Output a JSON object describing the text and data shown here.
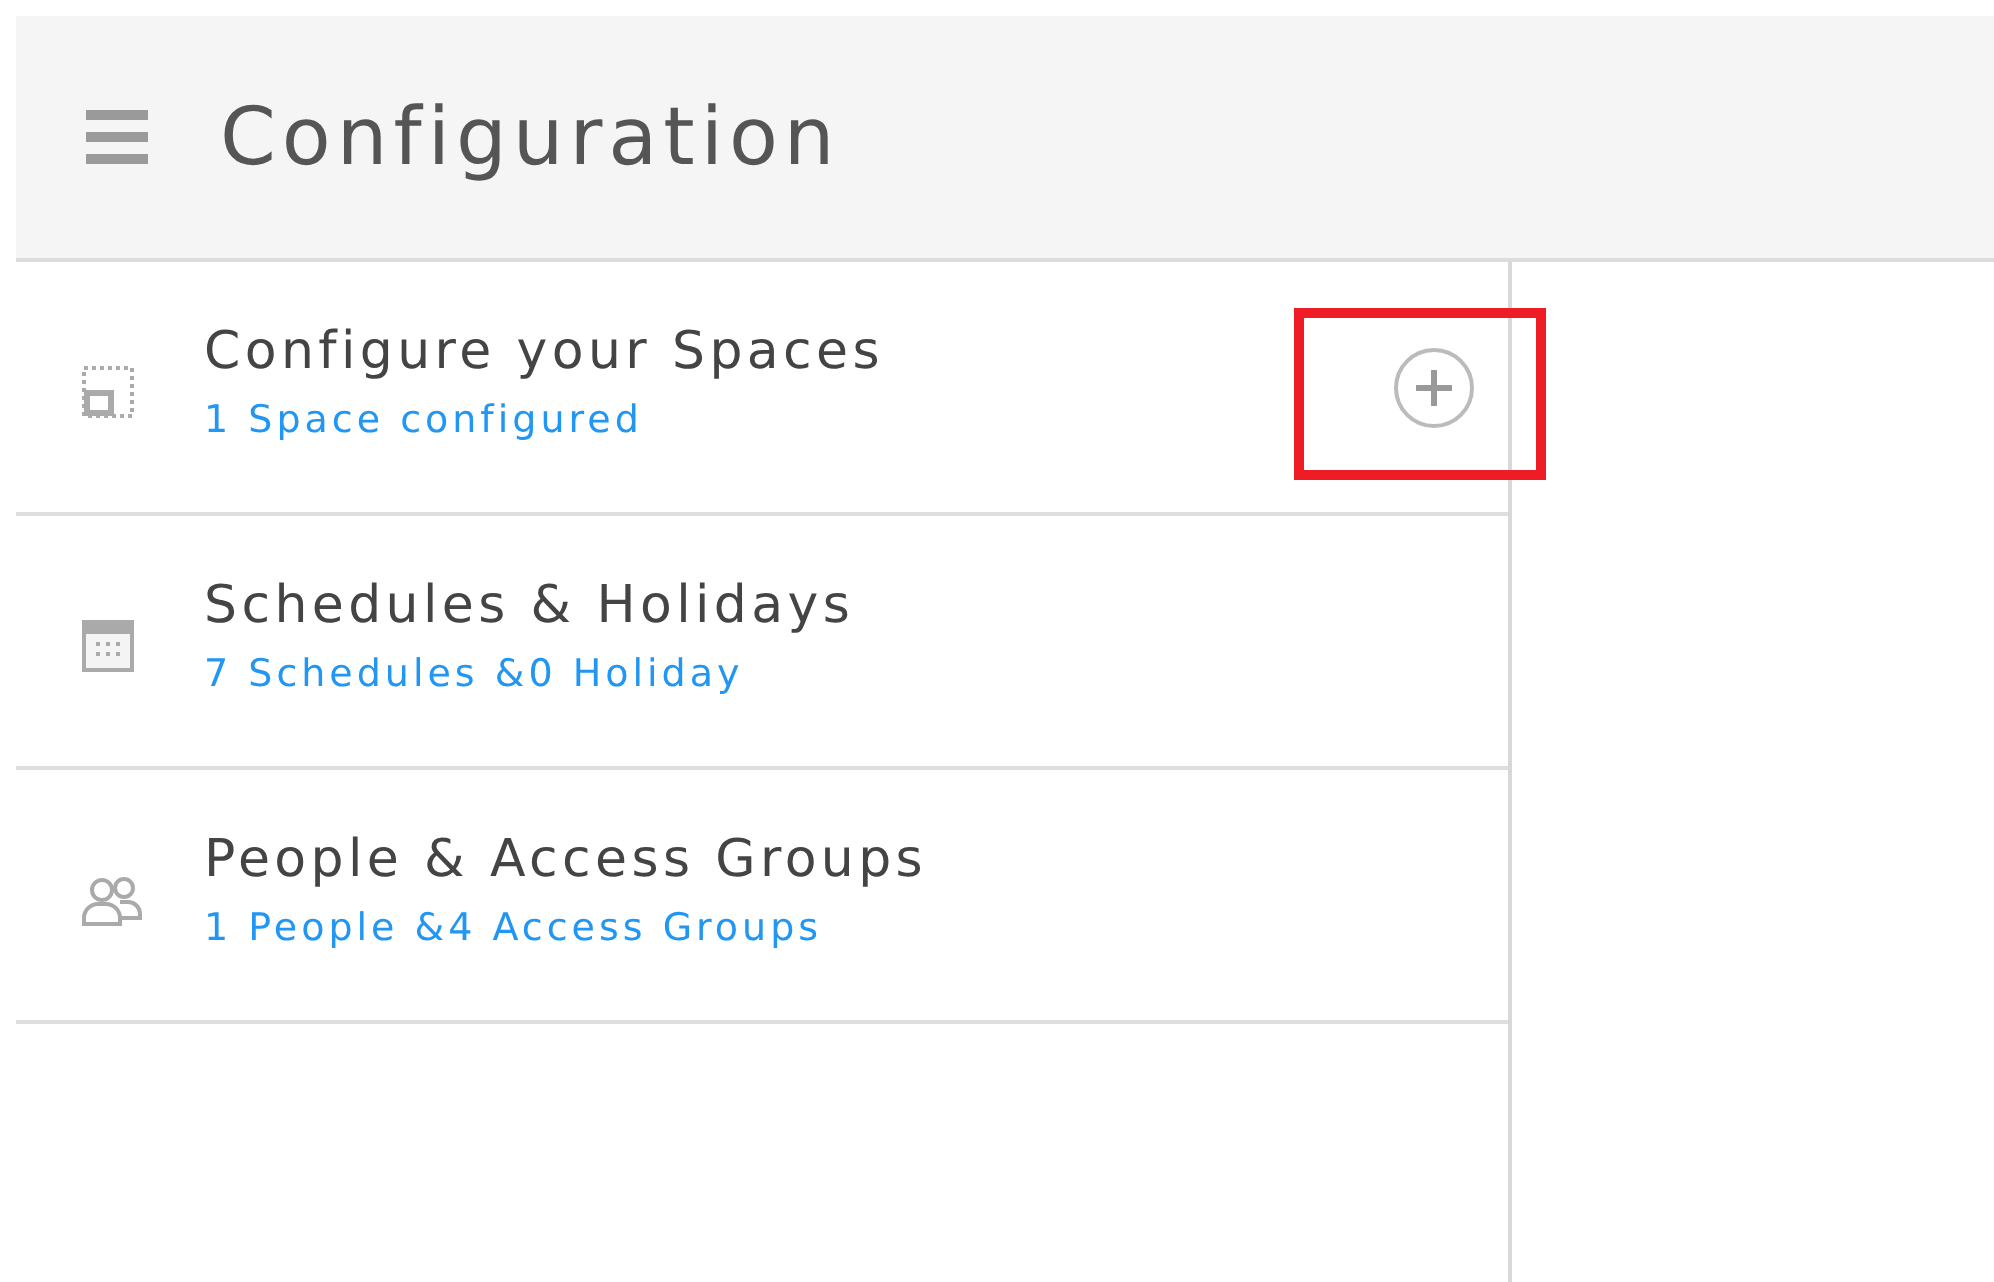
{
  "header": {
    "title": "Configuration"
  },
  "items": [
    {
      "kind": "spaces",
      "title": "Configure your Spaces",
      "subtitle": "1 Space configured",
      "add_button": true,
      "highlighted": true
    },
    {
      "kind": "schedules",
      "title": "Schedules & Holidays",
      "subtitle": "7 Schedules &0 Holiday",
      "add_button": false,
      "highlighted": false
    },
    {
      "kind": "people",
      "title": "People & Access Groups",
      "subtitle": "1 People &4 Access Groups",
      "add_button": false,
      "highlighted": false
    }
  ]
}
